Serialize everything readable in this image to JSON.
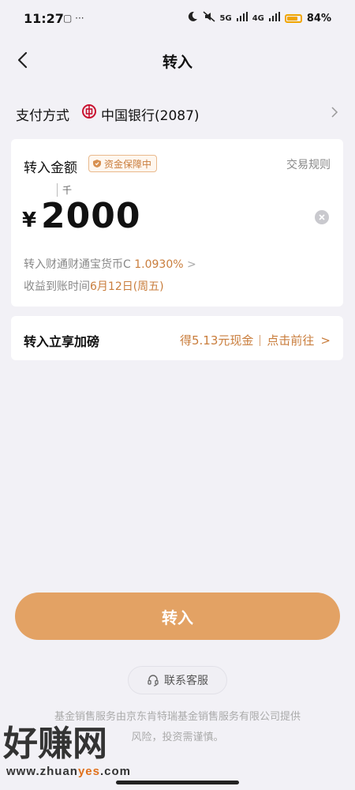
{
  "status_bar": {
    "time": "11:27",
    "left_icons": "▢ ···",
    "network1": "5G",
    "network2": "4G",
    "battery_percent": "84%",
    "battery_level": 0.84
  },
  "header": {
    "title": "转入"
  },
  "payment": {
    "label": "支付方式",
    "bank": "中国银行(2087)",
    "bank_color": "#c8102e"
  },
  "amount_card": {
    "label": "转入金额",
    "badge": "资金保障中",
    "rules_link": "交易规则",
    "unit_hint": "千",
    "currency_symbol": "¥",
    "amount": "2000",
    "fund_text": "转入财通财通宝货币C",
    "fund_rate": "1.0930%",
    "fund_chevron": ">",
    "date_text": "收益到账时间",
    "date_value": "6月12日(周五)"
  },
  "bonus": {
    "label": "转入立享加磅",
    "reward": "得5.13元现金",
    "action": "点击前往",
    "chevron": ">"
  },
  "submit_button": "转入",
  "service_button": "联系客服",
  "disclaimer": {
    "line1": "基金销售服务由京东肯特瑞基金销售服务有限公司提供",
    "line2": "风险，投资需谨慎。"
  },
  "watermark": {
    "logo": "好赚网",
    "url_prefix": "www.zhuan",
    "url_accent": "yes",
    "url_suffix": ".com"
  },
  "colors": {
    "accent": "#e3a264",
    "text_accent": "#c97d3c",
    "background": "#f2f1f6"
  }
}
